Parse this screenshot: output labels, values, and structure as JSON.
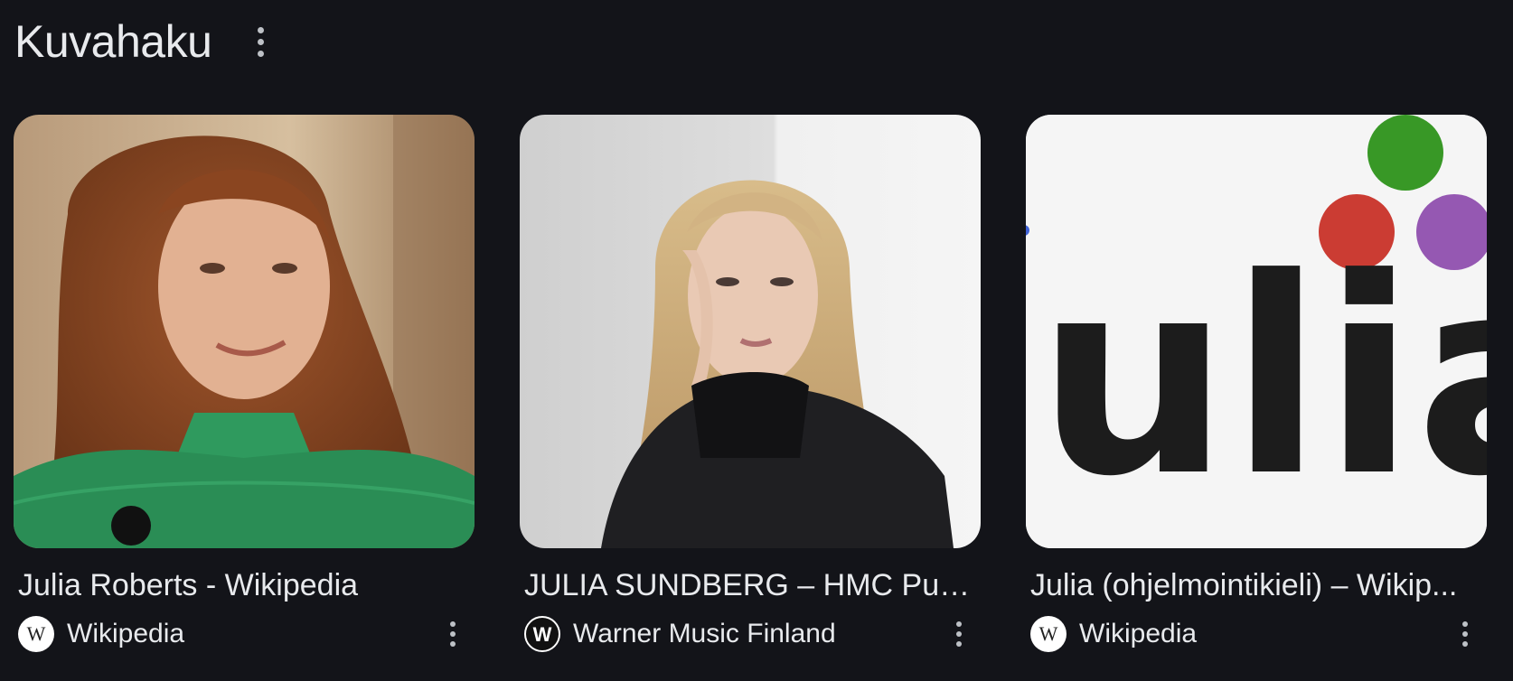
{
  "header": {
    "title": "Kuvahaku",
    "menu_icon": "more-vert-icon"
  },
  "results": [
    {
      "title": "Julia Roberts - Wikipedia",
      "source": "Wikipedia",
      "favicon_icon": "wikipedia-icon",
      "menu_icon": "more-vert-icon"
    },
    {
      "title": "JULIA SUNDBERG – HMC Pub...",
      "source": "Warner Music Finland",
      "favicon_icon": "warner-music-icon",
      "menu_icon": "more-vert-icon"
    },
    {
      "title": "Julia (ohjelmointikieli) – Wikip...",
      "source": "Wikipedia",
      "favicon_icon": "wikipedia-icon",
      "menu_icon": "more-vert-icon",
      "image_text": "ulia",
      "logo_colors": [
        "#389826",
        "#cb3c33",
        "#9558b2"
      ]
    }
  ],
  "colors": {
    "background": "#131419",
    "text": "#e8eaed"
  }
}
